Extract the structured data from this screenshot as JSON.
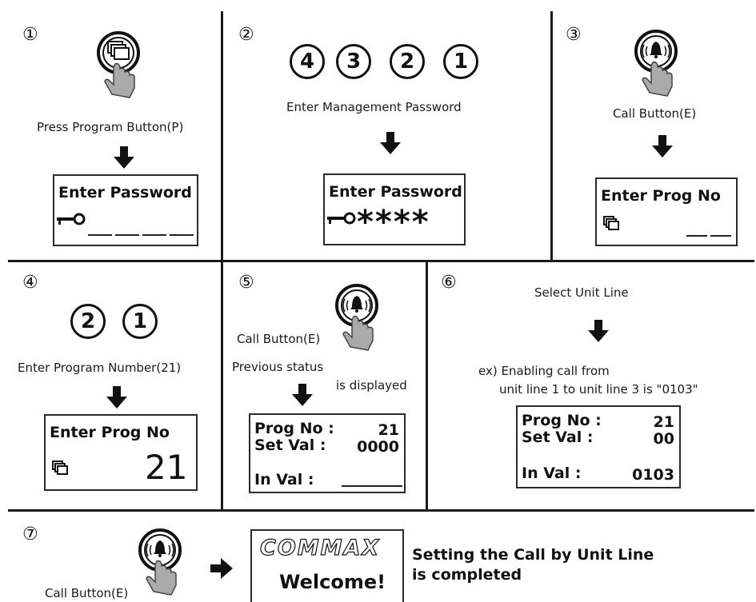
{
  "steps": {
    "s1": {
      "num": "①",
      "caption": "Press Program Button(P)",
      "lcd_title": "Enter Password"
    },
    "s2": {
      "num": "②",
      "digits": [
        "4",
        "3",
        "2",
        "1"
      ],
      "caption": "Enter Management Password",
      "lcd_title": "Enter Password",
      "stars": "****"
    },
    "s3": {
      "num": "③",
      "caption": "Call Button(E)",
      "lcd_title": "Enter Prog  No"
    },
    "s4": {
      "num": "④",
      "digits": [
        "2",
        "1"
      ],
      "caption": "Enter Program Number(21)",
      "lcd_title": "Enter Prog  No",
      "lcd_value": "21"
    },
    "s5": {
      "num": "⑤",
      "caption": "Call Button(E)",
      "note1": "Previous status",
      "note2": "is displayed",
      "prog_label": "Prog No :",
      "prog_value": "21",
      "set_label": "Set  Val  :",
      "set_value": "0000",
      "in_label": "In Val :"
    },
    "s6": {
      "num": "⑥",
      "caption": "Select Unit Line",
      "ex1": "ex) Enabling call from",
      "ex2": "unit line 1 to unit line 3 is \"0103\"",
      "prog_label": "Prog No :",
      "prog_value": "21",
      "set_label": "Set  Val  :",
      "set_value": "00",
      "in_label": "In Val :",
      "in_value": "0103"
    },
    "s7": {
      "num": "⑦",
      "caption": "Call Button(E)",
      "brand": "COMMAX",
      "welcome": "Welcome!",
      "done1": "Setting the Call by Unit Line",
      "done2": "is completed"
    }
  },
  "icons": {
    "program_button": "program-button-hand-icon",
    "call_button": "call-button-hand-icon",
    "key": "key-icon",
    "program": "program-icon",
    "arrow_down": "arrow-down-icon",
    "arrow_right": "arrow-right-icon"
  }
}
